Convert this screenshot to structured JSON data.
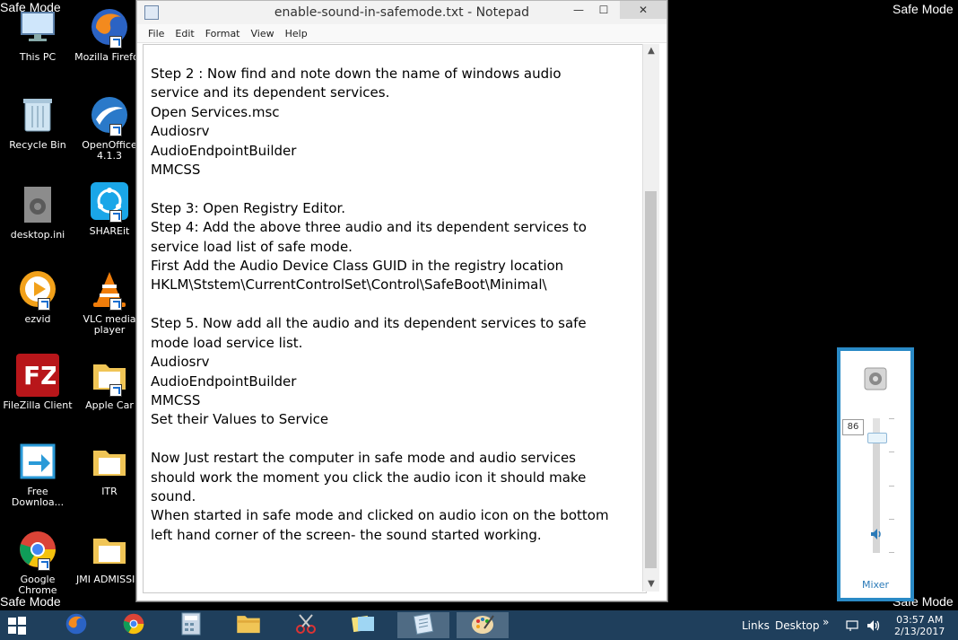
{
  "watermarks": {
    "top_left": "Safe Mode",
    "top_right": "Safe Mode",
    "bottom_left": "Safe Mode",
    "bottom_right": "Safe Mode"
  },
  "desktop_icons": [
    {
      "label": "This PC"
    },
    {
      "label": "Mozilla Firefox"
    },
    {
      "label": "Recycle Bin"
    },
    {
      "label": "OpenOffice 4.1.3"
    },
    {
      "label": "desktop.ini"
    },
    {
      "label": "SHAREit"
    },
    {
      "label": "ezvid"
    },
    {
      "label": "VLC media player"
    },
    {
      "label": "FileZilla Client"
    },
    {
      "label": "Apple Car"
    },
    {
      "label": "Free Downloa..."
    },
    {
      "label": "ITR"
    },
    {
      "label": "Google Chrome"
    },
    {
      "label": "JMI ADMISSIO"
    }
  ],
  "notepad": {
    "title": "enable-sound-in-safemode.txt - Notepad",
    "menu": [
      "File",
      "Edit",
      "Format",
      "View",
      "Help"
    ],
    "controls": {
      "minimize": "—",
      "maximize": "☐",
      "close": "✕"
    },
    "lines": [
      "Step 2 : Now find and note down the name of windows audio",
      "service and its dependent services.",
      "Open Services.msc",
      "Audiosrv",
      "AudioEndpointBuilder",
      "MMCSS",
      "",
      "Step 3: Open Registry Editor.",
      "Step 4: Add the above three audio and its dependent services to",
      "service load list of safe mode.",
      "First Add the Audio Device Class GUID in the registry location",
      "HKLM\\Ststem\\CurrentControlSet\\Control\\SafeBoot\\Minimal\\",
      "",
      "Step 5. Now add all the audio and its dependent services to safe",
      "mode load service list.",
      "Audiosrv",
      "AudioEndpointBuilder",
      "MMCSS",
      "Set their Values to Service",
      "",
      "Now Just restart the computer in safe mode and audio services",
      "should work the moment you click the audio icon it should make",
      "sound.",
      "When started in safe mode and clicked on audio icon on the bottom",
      "left hand corner of the screen- the sound started working."
    ]
  },
  "volume": {
    "level": "86",
    "mixer_label": "Mixer"
  },
  "taskbar": {
    "links": "Links",
    "desktop": "Desktop",
    "chevron": "»",
    "time": "03:57 AM",
    "date": "2/13/2017"
  }
}
